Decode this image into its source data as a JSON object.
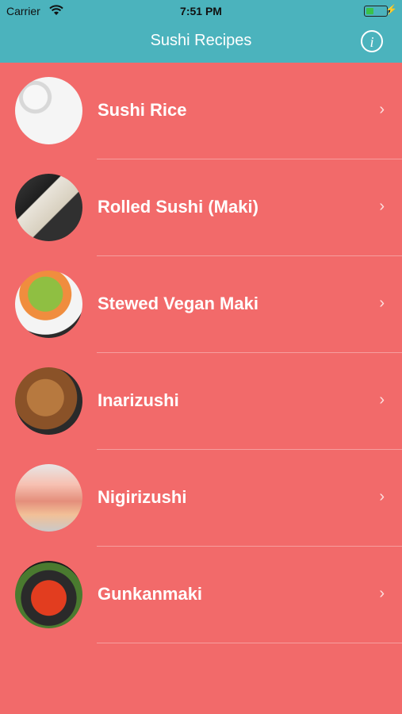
{
  "status_bar": {
    "carrier": "Carrier",
    "time": "7:51 PM"
  },
  "nav": {
    "title": "Sushi Recipes",
    "info_glyph": "i"
  },
  "recipes": [
    {
      "label": "Sushi Rice",
      "icon": "sushi-rice-photo"
    },
    {
      "label": "Rolled Sushi (Maki)",
      "icon": "maki-photo"
    },
    {
      "label": "Stewed Vegan Maki",
      "icon": "vegan-maki-photo"
    },
    {
      "label": "Inarizushi",
      "icon": "inarizushi-photo"
    },
    {
      "label": "Nigirizushi",
      "icon": "nigirizushi-photo"
    },
    {
      "label": "Gunkanmaki",
      "icon": "gunkanmaki-photo"
    }
  ],
  "colors": {
    "nav_background": "#4bb3bd",
    "list_background": "#f26a6a",
    "text": "#ffffff"
  }
}
